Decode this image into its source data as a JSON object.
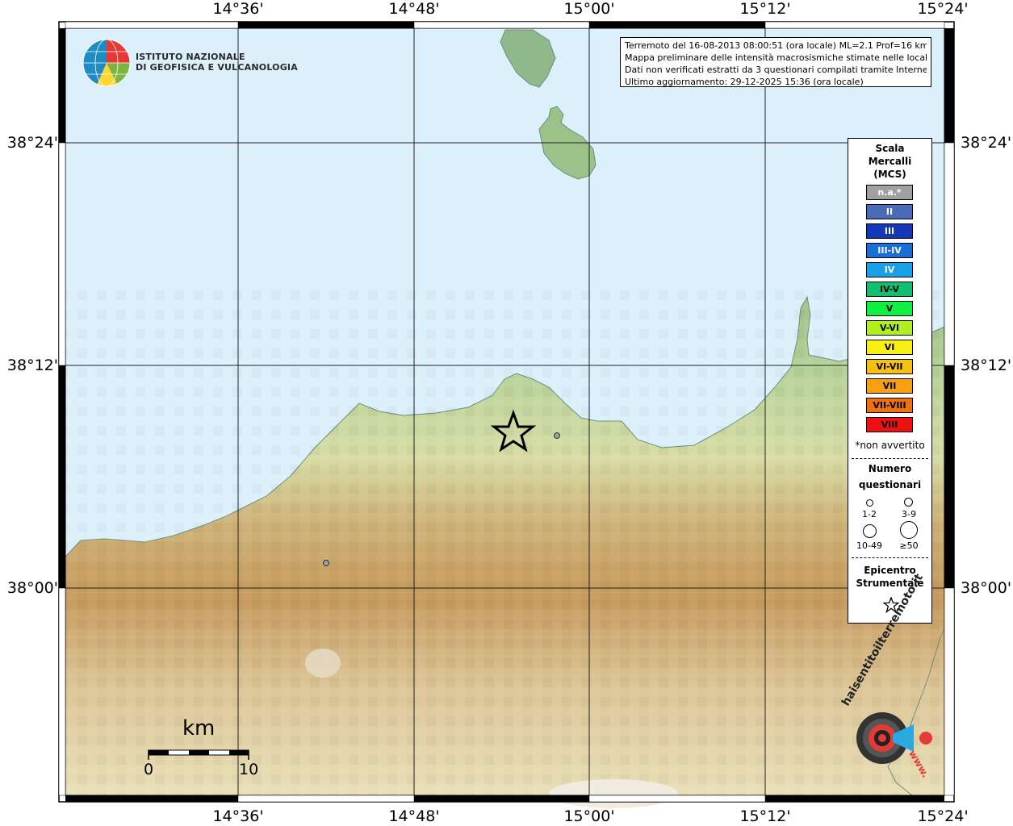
{
  "top_ticks": [
    "14°36'",
    "14°48'",
    "15°00'",
    "15°12'",
    "15°24'"
  ],
  "bottom_ticks": [
    "14°36'",
    "14°48'",
    "15°00'",
    "15°12'",
    "15°24'"
  ],
  "left_ticks": [
    "38°24'",
    "38°12'",
    "38°00'"
  ],
  "right_ticks": [
    "38°24'",
    "38°12'",
    "38°00'"
  ],
  "logo": {
    "line1": "ISTITUTO NAZIONALE",
    "line2": "DI GEOFISICA E VULCANOLOGIA"
  },
  "info": {
    "line1": "Terremoto del 16-08-2013 08:00:51 (ora locale) ML=2.1 Prof=16 km",
    "line2": "Mappa preliminare delle intensità macrosismiche stimate nelle località",
    "line3": "Dati non verificati estratti da 3 questionari compilati tramite Internet.",
    "line4": "Ultimo aggiornamento: 29-12-2025 15:36 (ora locale)"
  },
  "legend": {
    "title1": "Scala",
    "title2": "Mercalli",
    "title3": "(MCS)",
    "scale": [
      {
        "label": "n.a.*",
        "color": "#a0a0a0",
        "text": "#ffffff"
      },
      {
        "label": "II",
        "color": "#4a6cb8",
        "text": "#ffffff"
      },
      {
        "label": "III",
        "color": "#1238b8",
        "text": "#ffffff"
      },
      {
        "label": "III-IV",
        "color": "#1a6ed8",
        "text": "#ffffff"
      },
      {
        "label": "IV",
        "color": "#18a0e8",
        "text": "#ffffff"
      },
      {
        "label": "IV-V",
        "color": "#10c070",
        "text": "#000000"
      },
      {
        "label": "V",
        "color": "#10f040",
        "text": "#000000"
      },
      {
        "label": "V-VI",
        "color": "#b0f020",
        "text": "#000000"
      },
      {
        "label": "VI",
        "color": "#f8f010",
        "text": "#000000"
      },
      {
        "label": "VI-VII",
        "color": "#f8c010",
        "text": "#000000"
      },
      {
        "label": "VII",
        "color": "#f8a010",
        "text": "#000000"
      },
      {
        "label": "VII-VIII",
        "color": "#f07010",
        "text": "#000000"
      },
      {
        "label": "VIII",
        "color": "#f01010",
        "text": "#000000"
      }
    ],
    "note": "*non avvertito",
    "numero1": "Numero",
    "numero2": "questionari",
    "q1": "1-2",
    "q2": "3-9",
    "q3": "10-49",
    "q4": "≥50",
    "epi1": "Epicentro",
    "epi2": "Strumentale"
  },
  "scale_bar": {
    "unit": "km",
    "min": "0",
    "max": "10"
  },
  "watermark": {
    "text1": "haisentitoilterremoto.it",
    "text2": "www."
  }
}
